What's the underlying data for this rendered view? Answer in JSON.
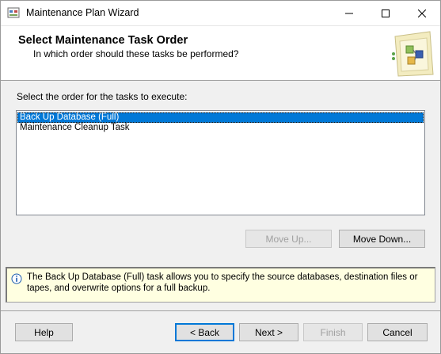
{
  "window": {
    "title": "Maintenance Plan Wizard",
    "icon": "wizard-app-icon"
  },
  "header": {
    "title": "Select Maintenance Task Order",
    "subtitle": "In which order should these tasks be performed?",
    "art_icon": "maintenance-plan-graphic"
  },
  "task_list": {
    "instruction": "Select the order for the tasks to execute:",
    "items": [
      {
        "label": "Back Up Database (Full)",
        "selected": true
      },
      {
        "label": "Maintenance Cleanup Task",
        "selected": false
      }
    ]
  },
  "order_buttons": {
    "move_up": "Move Up...",
    "move_down": "Move Down..."
  },
  "info": {
    "icon": "info-icon",
    "text": "The Back Up Database (Full) task allows you to specify the source databases, destination files or tapes, and overwrite options for a full backup."
  },
  "footer": {
    "help": "Help",
    "back": "< Back",
    "next": "Next >",
    "finish": "Finish",
    "cancel": "Cancel"
  },
  "colors": {
    "selection": "#0078d7",
    "info_background": "#ffffe1",
    "dialog_background": "#f0f0f0"
  }
}
